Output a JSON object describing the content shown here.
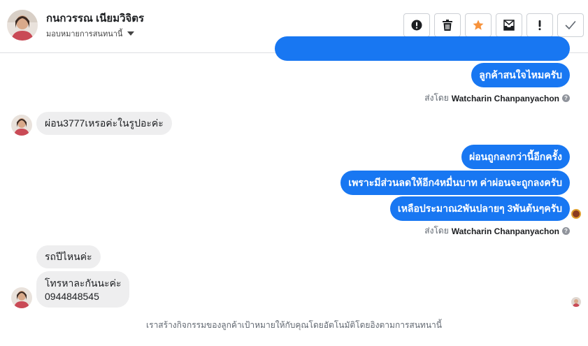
{
  "header": {
    "contact_name": "กนกวรรณ เนียมวิจิตร",
    "assign_label": "มอบหมายการสนทนานี้"
  },
  "toolbar": {
    "buttons": [
      {
        "name": "alert-circle",
        "icon": "exclamation-circle-icon"
      },
      {
        "name": "delete",
        "icon": "trash-icon"
      },
      {
        "name": "star",
        "icon": "star-icon",
        "color": "#f7923b"
      },
      {
        "name": "archive",
        "icon": "archive-icon"
      },
      {
        "name": "important",
        "icon": "exclamation-icon"
      },
      {
        "name": "done",
        "icon": "check-icon"
      }
    ]
  },
  "messages": {
    "out_1": "ลูกค้าสนใจไหมครับ",
    "sent_by_prefix": "ส่งโดย",
    "sent_by_name": "Watcharin Chanpanyachon",
    "in_1": "ผ่อน3777เหรอค่ะในรูปอะค่ะ",
    "out_2": "ผ่อนถูกลงกว่านี้อีกครั้ง",
    "out_3": "เพราะมีส่วนลดให้อีก4หมื่นบาท ค่าผ่อนจะถูกลงครับ",
    "out_4": "เหลือประมาณ2พันปลายๆ 3พันต้นๆครับ",
    "sent_by_prefix_2": "ส่งโดย",
    "sent_by_name_2": "Watcharin Chanpanyachon",
    "in_2": "รถปีไหนค่ะ",
    "in_3_line1": "โทรหาละกันนะค่ะ",
    "in_3_line2": "0944848545"
  },
  "footer": {
    "note": "เราสร้างกิจกรรมของลูกค้าเป้าหมายให้กับคุณโดยอัตโนมัติโดยอิงตามการสนทนานี้"
  },
  "colors": {
    "outgoing_bubble": "#1877f2",
    "incoming_bubble": "#eeeeef",
    "star": "#f7923b"
  }
}
